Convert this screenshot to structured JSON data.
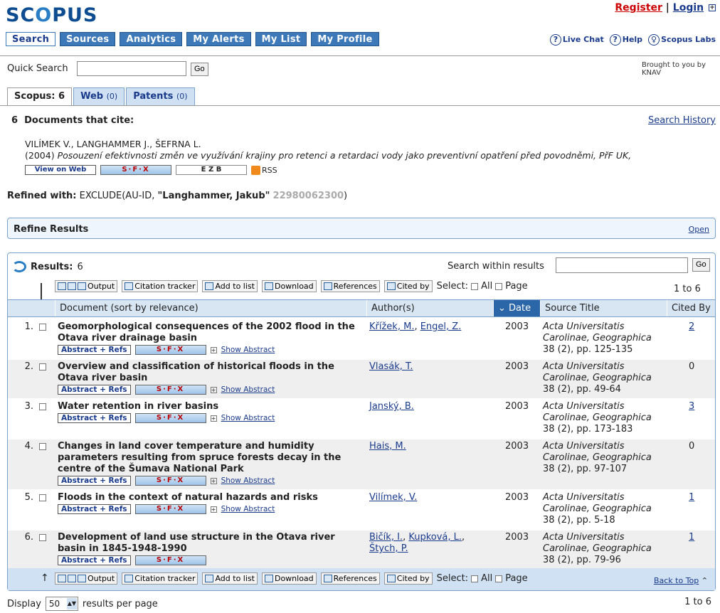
{
  "header": {
    "logo": "SCOPUS",
    "register": "Register",
    "separator": "|",
    "login": "Login",
    "nav": [
      "Search",
      "Sources",
      "Analytics",
      "My Alerts",
      "My List",
      "My Profile"
    ],
    "right_links": [
      "Live Chat",
      "Help",
      "Scopus Labs"
    ]
  },
  "quick_search": {
    "label": "Quick Search",
    "value": "",
    "go": "Go"
  },
  "brought": [
    "Brought to you by",
    "KNAV"
  ],
  "result_tabs": [
    {
      "label": "Scopus: 6",
      "count": ""
    },
    {
      "label": "Web",
      "count": "(0)"
    },
    {
      "label": "Patents",
      "count": "(0)"
    }
  ],
  "cite": {
    "heading": "6  Documents that cite:",
    "search_history": "Search History",
    "authors": "VILÍMEK V., LANGHAMMER J., ŠEFRNA L.",
    "year": "(2004)",
    "title": "Posouzení efektivnosti změn ve využívání krajiny pro retenci a retardaci vody jako preventivní opatření před povodněmi, PřF UK,",
    "view_on_web": "View on Web",
    "sfx": "S·F·X",
    "ezb": "E Z B",
    "rss": "RSS"
  },
  "refined": {
    "label": "Refined with:",
    "expr": "EXCLUDE(AU-ID, ",
    "name": "\"Langhammer, Jakub\"",
    "aid": "22980062300",
    "close": ")"
  },
  "refine": {
    "title": "Refine Results",
    "open": "Open"
  },
  "results": {
    "label": "Results:",
    "count": "6",
    "search_within": "Search within results",
    "search_value": "",
    "go": "Go",
    "toolbar": [
      "Output",
      "Citation tracker",
      "Add to list",
      "Download",
      "References",
      "Cited by"
    ],
    "select": "Select:",
    "all": "All",
    "page": "Page",
    "range": "1 to 6",
    "columns": [
      "Document (sort by relevance)",
      "Author(s)",
      "Date",
      "Source Title",
      "Cited By"
    ],
    "abstract_refs": "Abstract + Refs",
    "show_abstract": "Show Abstract",
    "back_to_top": "Back to Top"
  },
  "rows": [
    {
      "num": "1.",
      "title": "Geomorphological consequences of the 2002 flood in the Otava river drainage basin",
      "authors": [
        "Křížek, M.",
        "Engel, Z."
      ],
      "year": "2003",
      "source_1": "Acta Universitatis",
      "source_2": "Carolinae, Geographica",
      "source_3": "38 (2), pp. 125-135",
      "cited": "2",
      "cited_link": true
    },
    {
      "num": "2.",
      "title": "Overview and classification of historical floods in the Otava river basin",
      "authors": [
        "Vlasák, T."
      ],
      "year": "2003",
      "source_1": "Acta Universitatis",
      "source_2": "Carolinae, Geographica",
      "source_3": "38 (2), pp. 49-64",
      "cited": "0",
      "cited_link": false
    },
    {
      "num": "3.",
      "title": "Water retention in river basins",
      "authors": [
        "Janský, B."
      ],
      "year": "2003",
      "source_1": "Acta Universitatis",
      "source_2": "Carolinae, Geographica",
      "source_3": "38 (2), pp. 173-183",
      "cited": "3",
      "cited_link": true
    },
    {
      "num": "4.",
      "title": "Changes in land cover temperature and humidity parameters resulting from spruce forests decay in the centre of the Šumava National Park",
      "authors": [
        "Hais, M."
      ],
      "year": "2003",
      "source_1": "Acta Universitatis",
      "source_2": "Carolinae, Geographica",
      "source_3": "38 (2), pp. 97-107",
      "cited": "0",
      "cited_link": false
    },
    {
      "num": "5.",
      "title": "Floods in the context of natural hazards and risks",
      "authors": [
        "Vilímek, V."
      ],
      "year": "2003",
      "source_1": "Acta Universitatis",
      "source_2": "Carolinae, Geographica",
      "source_3": "38 (2), pp. 5-18",
      "cited": "1",
      "cited_link": true
    },
    {
      "num": "6.",
      "title": "Development of land use structure in the Otava river basin in 1845-1948-1990",
      "authors": [
        "Bičík, I.",
        "Kupková, L.",
        "Štych, P."
      ],
      "year": "2003",
      "source_1": "Acta Universitatis",
      "source_2": "Carolinae, Geographica",
      "source_3": "38 (2), pp. 79-96",
      "cited": "1",
      "cited_link": true
    }
  ],
  "display": {
    "label": "Display",
    "value": "50",
    "suffix": "results per page",
    "range": "1 to 6"
  }
}
